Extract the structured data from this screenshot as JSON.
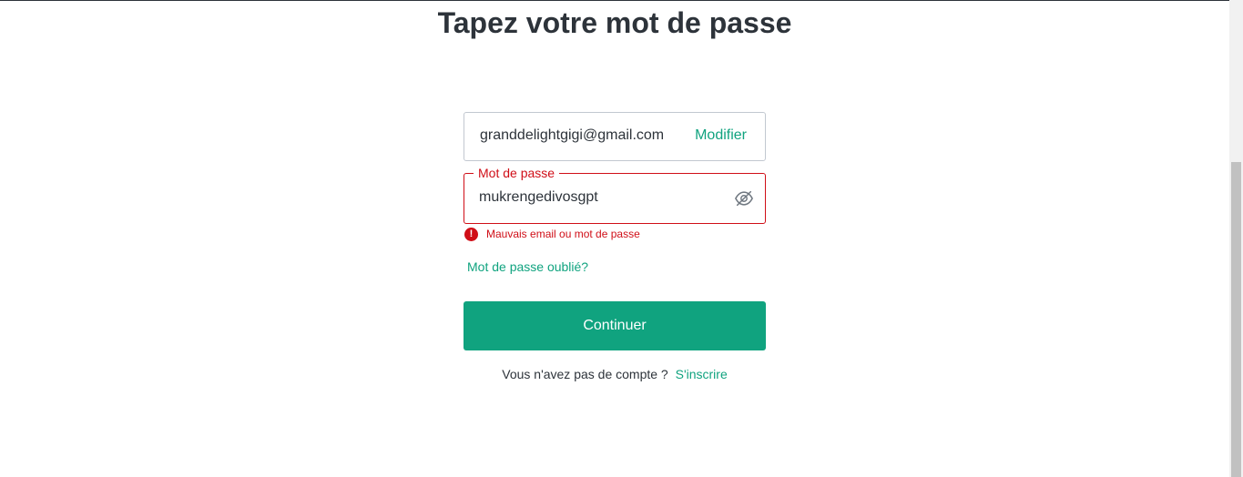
{
  "page": {
    "title": "Tapez votre mot de passe"
  },
  "email_field": {
    "value": "granddelightgigi@gmail.com",
    "edit_label": "Modifier"
  },
  "password_field": {
    "label": "Mot de passe",
    "value": "mukrengedivosgpt",
    "toggle_icon": "eye-slash-icon"
  },
  "error": {
    "icon": "alert-circle-icon",
    "icon_glyph": "!",
    "message": "Mauvais email ou mot de passe"
  },
  "forgot_password": {
    "label": "Mot de passe oublié?"
  },
  "continue_button": {
    "label": "Continuer"
  },
  "signup": {
    "prompt": "Vous n'avez pas de compte ?",
    "link": "S'inscrire"
  },
  "colors": {
    "accent": "#10a37f",
    "error": "#d00e17",
    "text": "#2d333a",
    "border": "#c2c8d0"
  }
}
